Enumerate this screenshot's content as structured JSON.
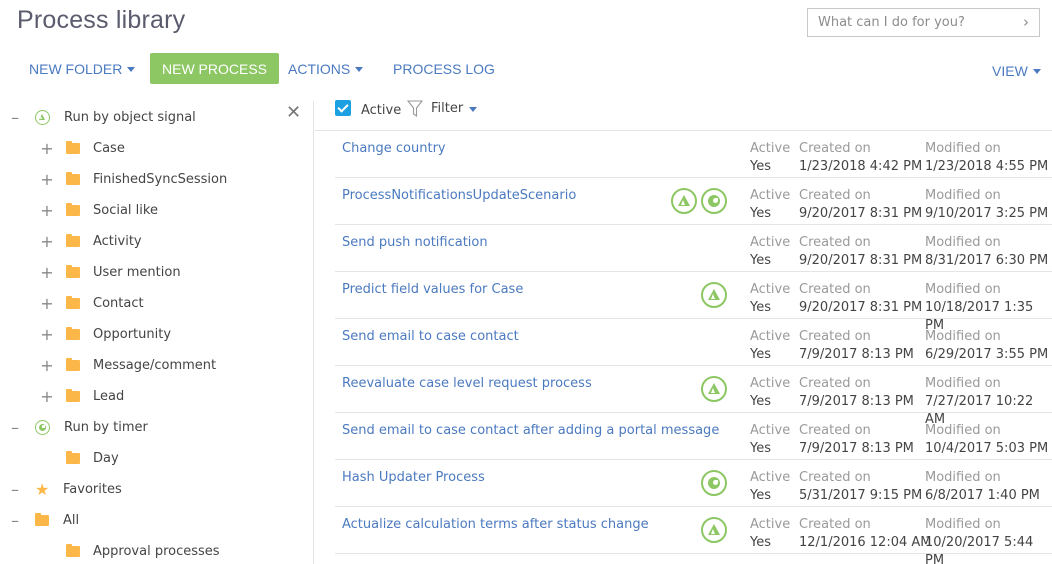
{
  "header": {
    "title": "Process library",
    "search_placeholder": "What can I do for you?"
  },
  "toolbar": {
    "new_folder": "NEW FOLDER",
    "new_process": "NEW PROCESS",
    "actions": "ACTIONS",
    "process_log": "PROCESS LOG",
    "view": "VIEW",
    "accent_color": "#8dc764",
    "link_color": "#4b7ac0"
  },
  "sidebar": {
    "groups": [
      {
        "label": "Run by object signal",
        "icon": "signal-icon",
        "expanded": true,
        "children": [
          "Case",
          "FinishedSyncSession",
          "Social like",
          "Activity",
          "User mention",
          "Contact",
          "Opportunity",
          "Message/comment",
          "Lead"
        ]
      },
      {
        "label": "Run by timer",
        "icon": "timer-icon",
        "expanded": true,
        "children": [
          "Day"
        ]
      },
      {
        "label": "Favorites",
        "icon": "star-icon",
        "expanded": true,
        "children": []
      },
      {
        "label": "All",
        "icon": "folder-icon",
        "expanded": true,
        "children": [
          "Approval processes"
        ]
      }
    ]
  },
  "filter": {
    "active_label": "Active",
    "active_checked": true,
    "filter_label": "Filter"
  },
  "grid": {
    "captions": {
      "active": "Active",
      "created": "Created on",
      "modified": "Modified on"
    },
    "rows": [
      {
        "name": "Change country",
        "icons": [],
        "active": "Yes",
        "created": "1/23/2018 4:42 PM",
        "modified": "1/23/2018 4:55 PM"
      },
      {
        "name": "ProcessNotificationsUpdateScenario",
        "icons": [
          "signal",
          "timer"
        ],
        "active": "Yes",
        "created": "9/20/2017 8:31 PM",
        "modified": "9/10/2017 3:25 PM"
      },
      {
        "name": "Send push notification",
        "icons": [],
        "active": "Yes",
        "created": "9/20/2017 8:31 PM",
        "modified": "8/31/2017 6:30 PM"
      },
      {
        "name": "Predict field values for Case",
        "icons": [
          "signal"
        ],
        "active": "Yes",
        "created": "9/20/2017 8:31 PM",
        "modified": "10/18/2017 1:35 PM"
      },
      {
        "name": "Send email to case contact",
        "icons": [],
        "active": "Yes",
        "created": "7/9/2017 8:13 PM",
        "modified": "6/29/2017 3:55 PM"
      },
      {
        "name": "Reevaluate case level request process",
        "icons": [
          "signal"
        ],
        "active": "Yes",
        "created": "7/9/2017 8:13 PM",
        "modified": "7/27/2017 10:22 AM"
      },
      {
        "name": "Send email to case contact after adding a portal message",
        "icons": [],
        "active": "Yes",
        "created": "7/9/2017 8:13 PM",
        "modified": "10/4/2017 5:03 PM"
      },
      {
        "name": "Hash Updater Process",
        "icons": [
          "timer"
        ],
        "active": "Yes",
        "created": "5/31/2017 9:15 PM",
        "modified": "6/8/2017 1:40 PM"
      },
      {
        "name": "Actualize calculation terms after status change",
        "icons": [
          "signal"
        ],
        "active": "Yes",
        "created": "12/1/2016 12:04 AM",
        "modified": "10/20/2017 5:44 PM"
      }
    ]
  }
}
